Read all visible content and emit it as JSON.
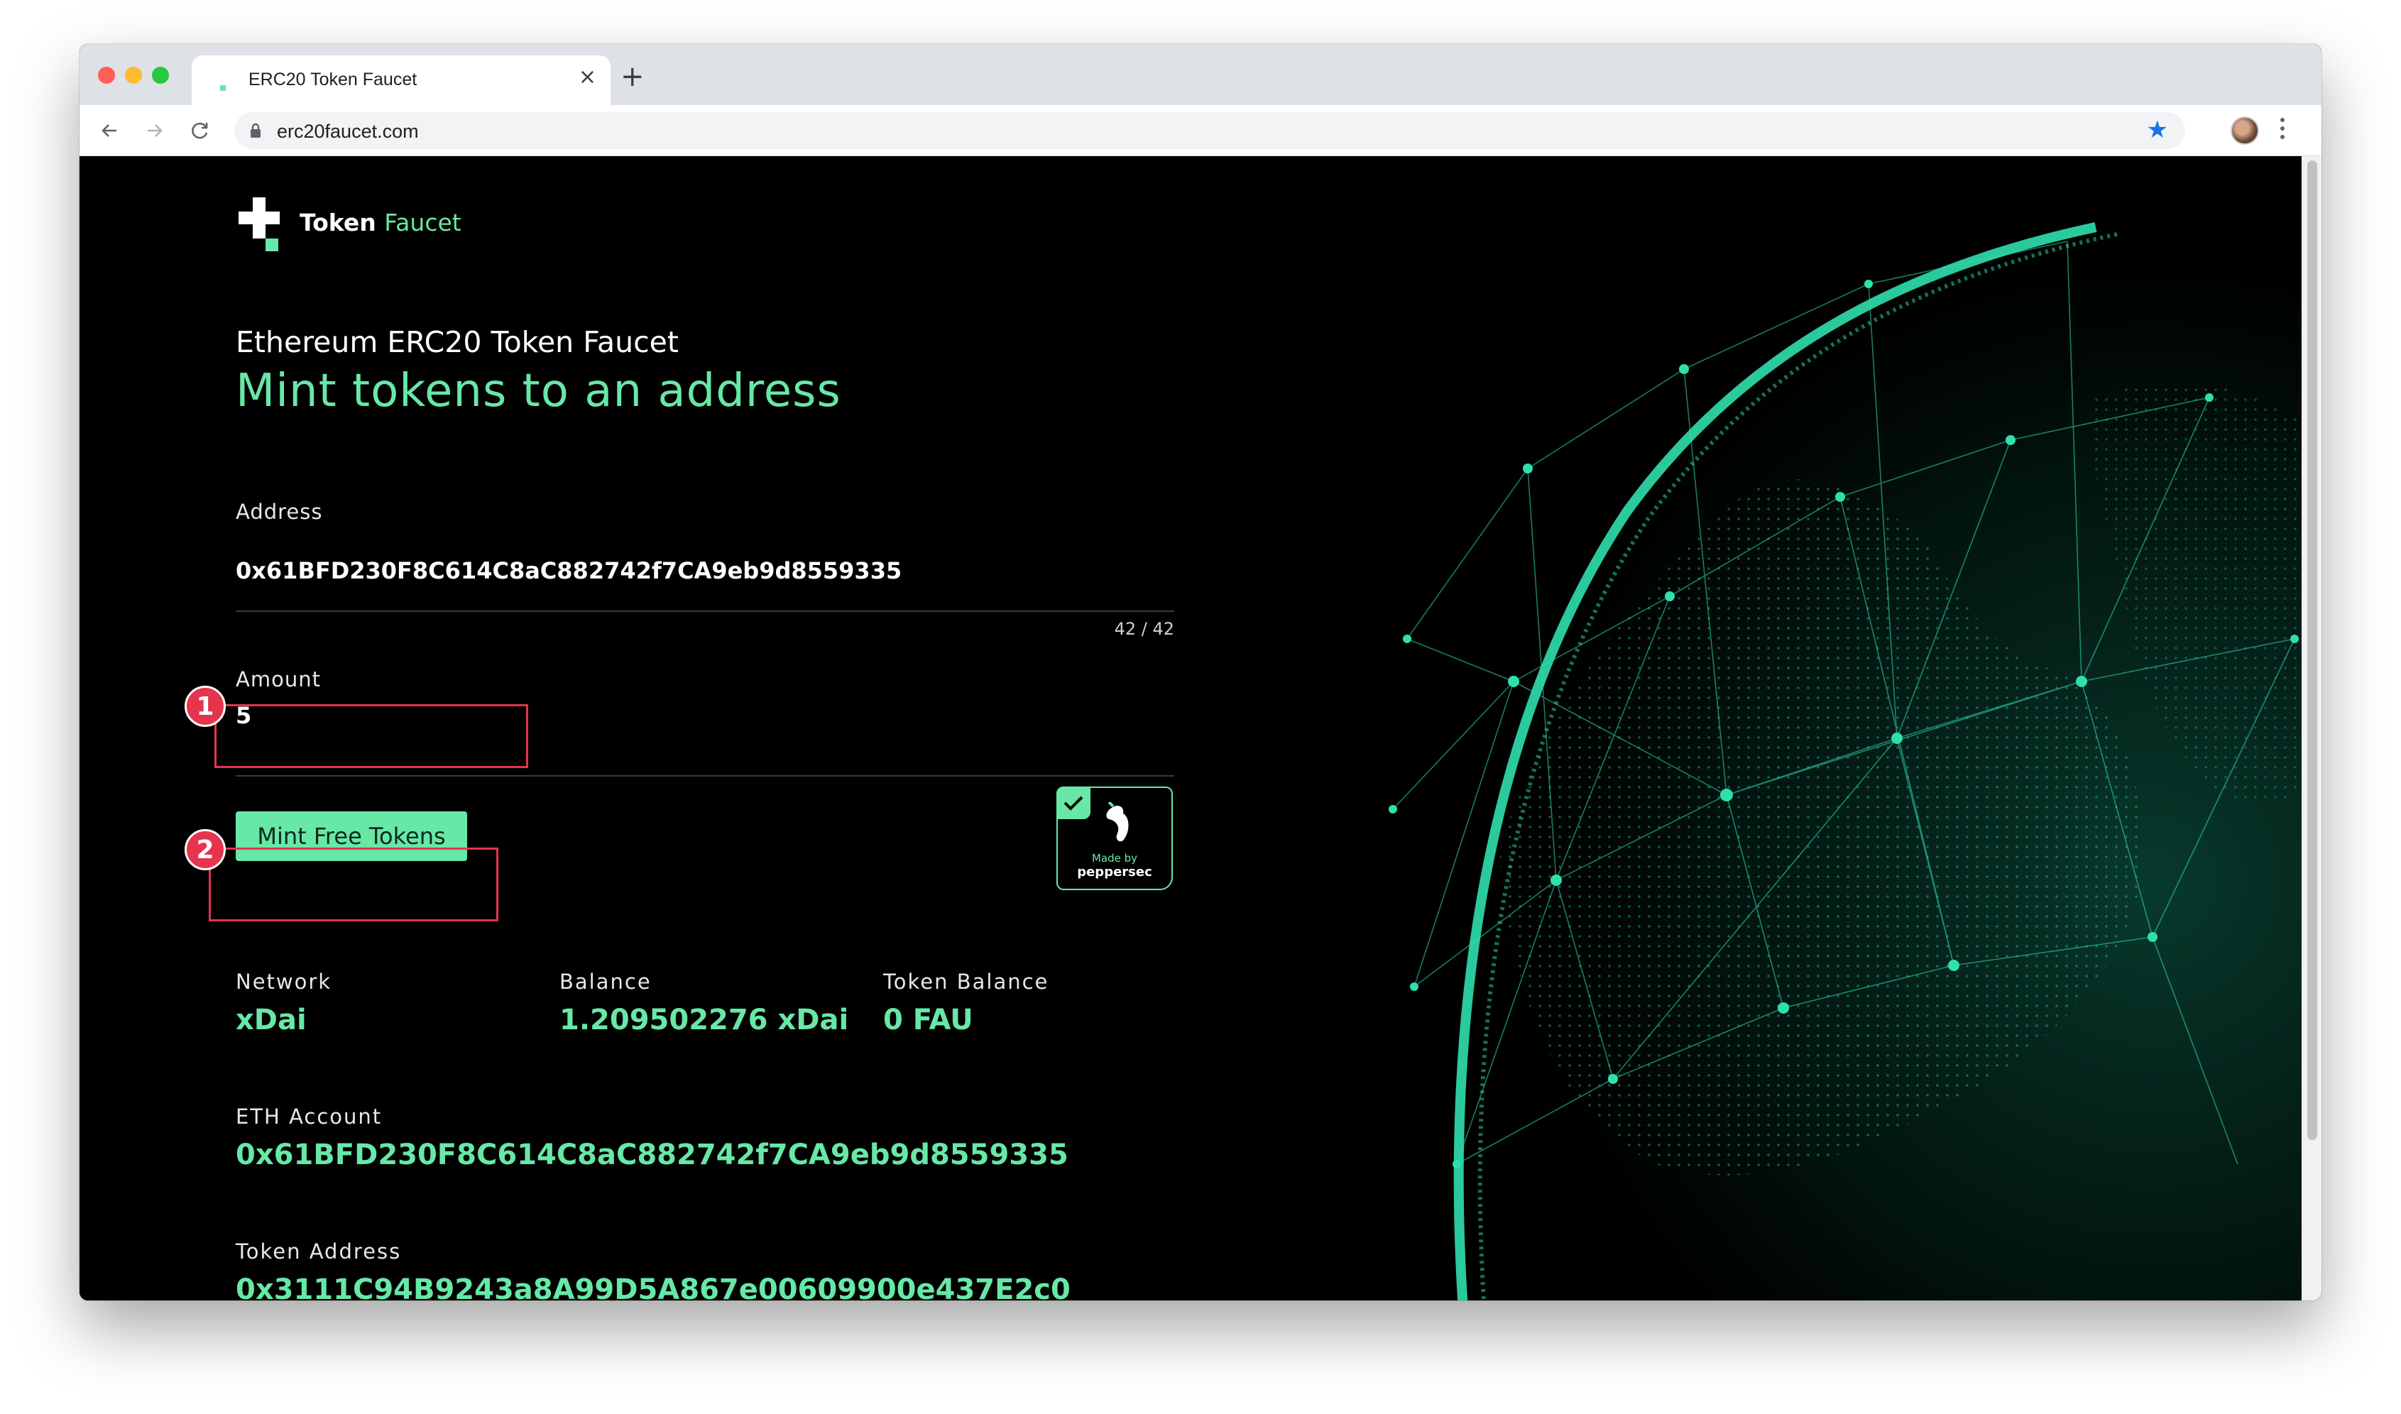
{
  "browser": {
    "tab_title": "ERC20 Token Faucet",
    "tab_close": "×",
    "new_tab": "+",
    "url": "erc20faucet.com"
  },
  "app": {
    "brand_primary": "Token",
    "brand_accent": "Faucet",
    "subheading": "Ethereum ERC20 Token Faucet",
    "heading": "Mint tokens to an address",
    "address": {
      "label": "Address",
      "value": "0x61BFD230F8C614C8aC882742f7CA9eb9d8559335",
      "counter": "42 / 42"
    },
    "amount": {
      "label": "Amount",
      "value": "5"
    },
    "mint_button": "Mint Free Tokens",
    "pepper_badge": {
      "made_by": "Made by",
      "name": "peppersec"
    },
    "stats": {
      "network_label": "Network",
      "network_value": "xDai",
      "balance_label": "Balance",
      "balance_value": "1.209502276 xDai",
      "token_balance_label": "Token Balance",
      "token_balance_value": "0 FAU"
    },
    "eth_account": {
      "label": "ETH Account",
      "value": "0x61BFD230F8C614C8aC882742f7CA9eb9d8559335"
    },
    "token_address": {
      "label": "Token Address",
      "value": "0x3111C94B9243a8A99D5A867e00609900e437E2c0"
    }
  },
  "annotations": [
    "1",
    "2"
  ],
  "colors": {
    "accent": "#67e8a6",
    "highlight": "#e5344e",
    "background": "#000000"
  }
}
